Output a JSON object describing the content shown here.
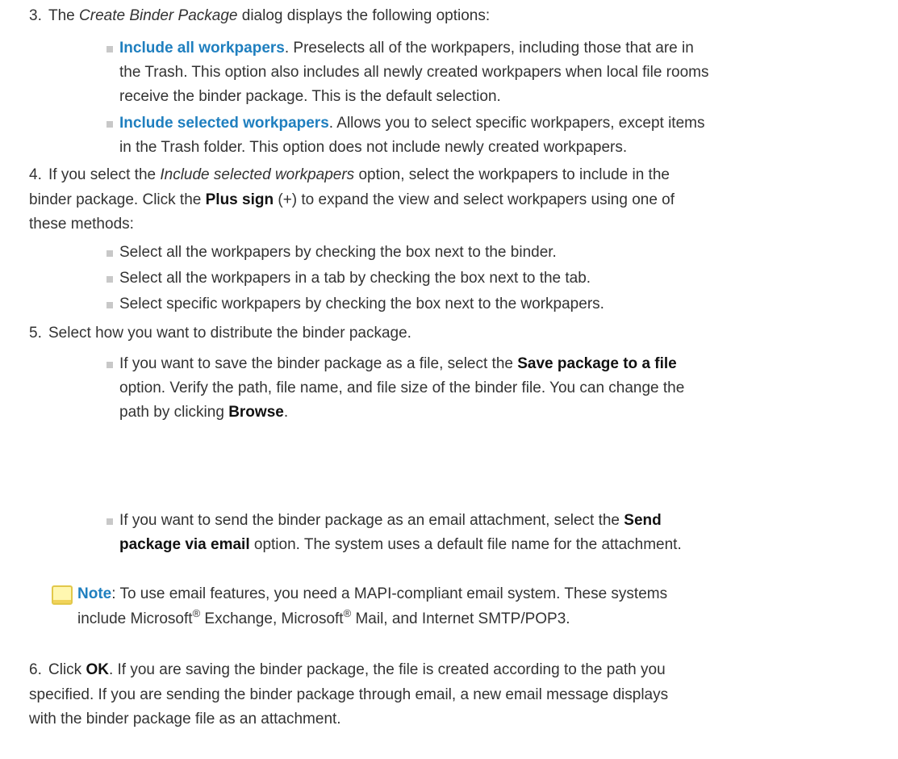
{
  "step3": {
    "num": "3.",
    "pre": "The ",
    "italic": "Create Binder Package",
    "post": " dialog displays the following options:",
    "bullets": [
      {
        "link": "Include all workpapers",
        "line1": ". Preselects all of the workpapers, including those that are in",
        "line2": "the Trash. This option also includes all newly created workpapers when local file rooms",
        "line3": "receive the binder package. This is the default selection."
      },
      {
        "link": "Include selected workpapers",
        "line1": ". Allows you to select specific workpapers, except items",
        "line2": "in the Trash folder. This option does not include newly created workpapers."
      }
    ]
  },
  "step4": {
    "num": "4.",
    "pre": "If you select the ",
    "italic": "Include selected workpapers",
    "post": " option, select the workpapers to include in the",
    "line2a": "binder package. Click the ",
    "bold": "Plus sign",
    "line2b": " (+) to expand the view and select workpapers using one of",
    "line3": "these methods:",
    "bullets": [
      "Select all the workpapers by checking the box next to the binder.",
      "Select all the workpapers in a tab by checking the box next to the tab.",
      "Select specific workpapers by checking the box next to the workpapers."
    ]
  },
  "step5": {
    "num": "5.",
    "text": "Select how you want to distribute the binder package.",
    "bullet1": {
      "pre": "If you want to save the binder package as a file, select the ",
      "bold": "Save package to a file",
      "line2": "option. Verify the path, file name, and file size of the binder file. You can change the",
      "line3a": "path by clicking ",
      "bold2": "Browse",
      "line3b": "."
    },
    "bullet2": {
      "pre": "If you want to send the binder package as an email attachment, select the ",
      "bold": "Send",
      "bold_line2": "package via email",
      "line2": " option. The system uses a default file name for the attachment."
    }
  },
  "note": {
    "label": "Note",
    "line1": ": To use email features, you need a MAPI-compliant email system. These systems",
    "line2a": "include Microsoft",
    "reg": "®",
    "line2b": " Exchange, Microsoft",
    "line2c": " Mail, and Internet SMTP/POP3."
  },
  "step6": {
    "num": "6.",
    "pre": "Click ",
    "bold": "OK",
    "line1": ". If you are saving the binder package, the file is created according to the path you",
    "line2": "specified. If you are sending the binder package through email, a new email message displays",
    "line3": "with the binder package file as an attachment."
  },
  "colors": {
    "link": "#1f7fbf",
    "text": "#333333",
    "bullet": "#c8c8c8",
    "note_icon": "#fff7b0"
  }
}
